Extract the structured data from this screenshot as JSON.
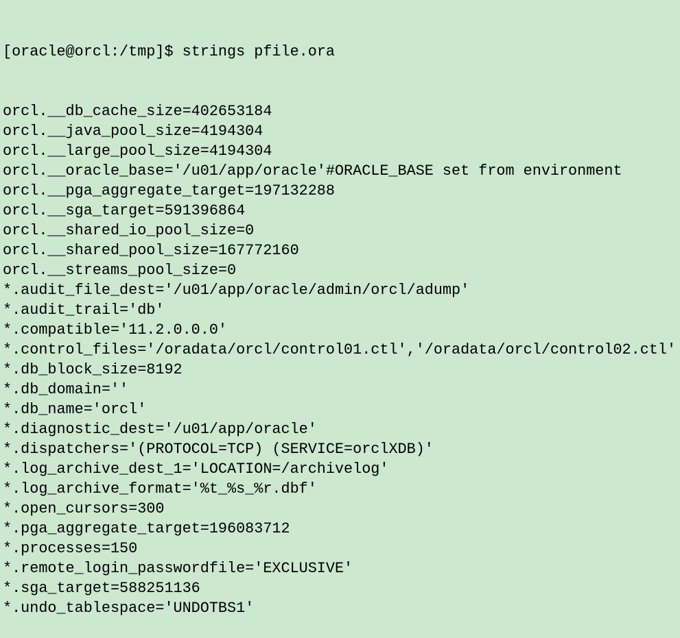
{
  "terminal": {
    "prompt": "[oracle@orcl:/tmp]$ ",
    "command": "strings pfile.ora",
    "output": [
      "orcl.__db_cache_size=402653184",
      "orcl.__java_pool_size=4194304",
      "orcl.__large_pool_size=4194304",
      "orcl.__oracle_base='/u01/app/oracle'#ORACLE_BASE set from environment",
      "orcl.__pga_aggregate_target=197132288",
      "orcl.__sga_target=591396864",
      "orcl.__shared_io_pool_size=0",
      "orcl.__shared_pool_size=167772160",
      "orcl.__streams_pool_size=0",
      "*.audit_file_dest='/u01/app/oracle/admin/orcl/adump'",
      "*.audit_trail='db'",
      "*.compatible='11.2.0.0.0'",
      "*.control_files='/oradata/orcl/control01.ctl','/oradata/orcl/control02.ctl'",
      "*.db_block_size=8192",
      "*.db_domain=''",
      "*.db_name='orcl'",
      "*.diagnostic_dest='/u01/app/oracle'",
      "*.dispatchers='(PROTOCOL=TCP) (SERVICE=orclXDB)'",
      "*.log_archive_dest_1='LOCATION=/archivelog'",
      "*.log_archive_format='%t_%s_%r.dbf'",
      "*.open_cursors=300",
      "*.pga_aggregate_target=196083712",
      "*.processes=150",
      "*.remote_login_passwordfile='EXCLUSIVE'",
      "*.sga_target=588251136",
      "*.undo_tablespace='UNDOTBS1'"
    ],
    "colors": {
      "background": "#cce8cf",
      "text": "#000000"
    }
  }
}
